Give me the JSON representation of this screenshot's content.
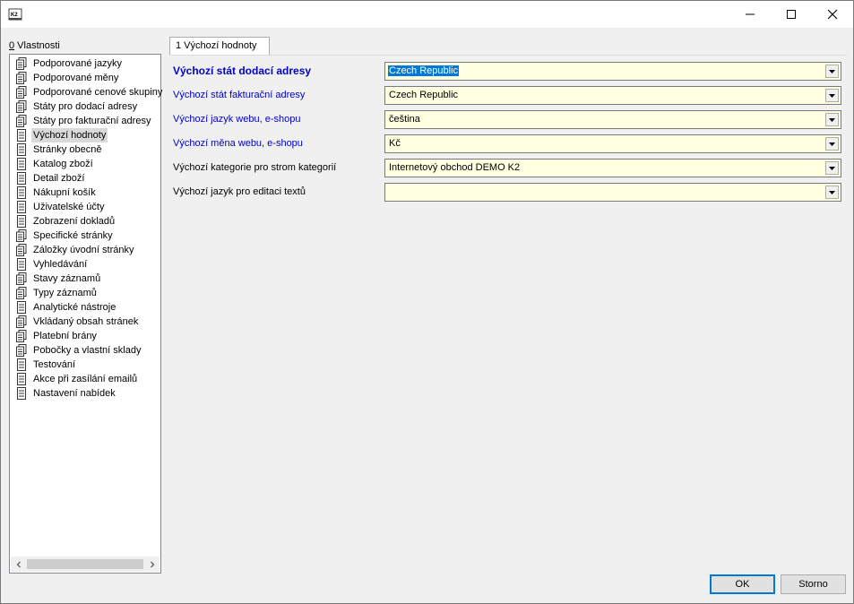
{
  "titlebar": {
    "app_icon": "k2-app-icon",
    "minimize_icon": "minimize-icon",
    "maximize_icon": "maximize-icon",
    "close_icon": "close-icon"
  },
  "left_panel": {
    "caption_hotkey": "0",
    "caption_rest": " Vlastnosti",
    "items": [
      {
        "label": "Podporované jazyky",
        "icon": "document-stack-icon"
      },
      {
        "label": "Podporované měny",
        "icon": "document-stack-icon"
      },
      {
        "label": "Podporované cenové skupiny",
        "icon": "document-stack-icon"
      },
      {
        "label": "Státy pro dodací adresy",
        "icon": "document-stack-icon"
      },
      {
        "label": "Státy pro fakturační adresy",
        "icon": "document-stack-icon"
      },
      {
        "label": "Výchozí hodnoty",
        "icon": "document-icon",
        "selected": true
      },
      {
        "label": "Stránky obecně",
        "icon": "document-icon"
      },
      {
        "label": "Katalog zboží",
        "icon": "document-icon"
      },
      {
        "label": "Detail zboží",
        "icon": "document-icon"
      },
      {
        "label": "Nákupní košík",
        "icon": "document-icon"
      },
      {
        "label": "Uživatelské účty",
        "icon": "document-icon"
      },
      {
        "label": "Zobrazení dokladů",
        "icon": "document-icon"
      },
      {
        "label": "Specifické stránky",
        "icon": "document-stack-icon"
      },
      {
        "label": "Záložky úvodní stránky",
        "icon": "document-stack-icon"
      },
      {
        "label": "Vyhledávání",
        "icon": "document-icon"
      },
      {
        "label": "Stavy záznamů",
        "icon": "document-stack-icon"
      },
      {
        "label": "Typy záznamů",
        "icon": "document-stack-icon"
      },
      {
        "label": "Analytické nástroje",
        "icon": "document-icon"
      },
      {
        "label": "Vkládaný obsah stránek",
        "icon": "document-stack-icon"
      },
      {
        "label": "Platební brány",
        "icon": "document-stack-icon"
      },
      {
        "label": "Pobočky a vlastní sklady",
        "icon": "document-stack-icon"
      },
      {
        "label": "Testování",
        "icon": "document-icon"
      },
      {
        "label": "Akce při zasílání emailů",
        "icon": "document-icon"
      },
      {
        "label": "Nastavení nabídek",
        "icon": "document-icon"
      }
    ],
    "scroll_left_icon": "chevron-left-icon",
    "scroll_right_icon": "chevron-right-icon"
  },
  "tab": {
    "label": "1 Výchozí hodnoty"
  },
  "form": {
    "rows": [
      {
        "label": "Výchozí stát dodací adresy",
        "value": "Czech Republic"
      },
      {
        "label": "Výchozí stát fakturační adresy",
        "value": "Czech Republic"
      },
      {
        "label": "Výchozí jazyk webu, e-shopu",
        "value": "čeština"
      },
      {
        "label": "Výchozí měna webu, e-shopu",
        "value": "Kč"
      },
      {
        "label": "Výchozí kategorie pro strom kategorií",
        "value": "Internetový obchod DEMO K2"
      },
      {
        "label": "Výchozí jazyk pro editaci textů",
        "value": ""
      }
    ],
    "dropdown_icon": "chevron-down-icon"
  },
  "buttons": {
    "ok": "OK",
    "cancel": "Storno"
  },
  "colors": {
    "field_bg": "#ffffe1",
    "label_blue": "#0000c8",
    "selection": "#0078d7",
    "tree_selected": "#d9d9d9"
  }
}
